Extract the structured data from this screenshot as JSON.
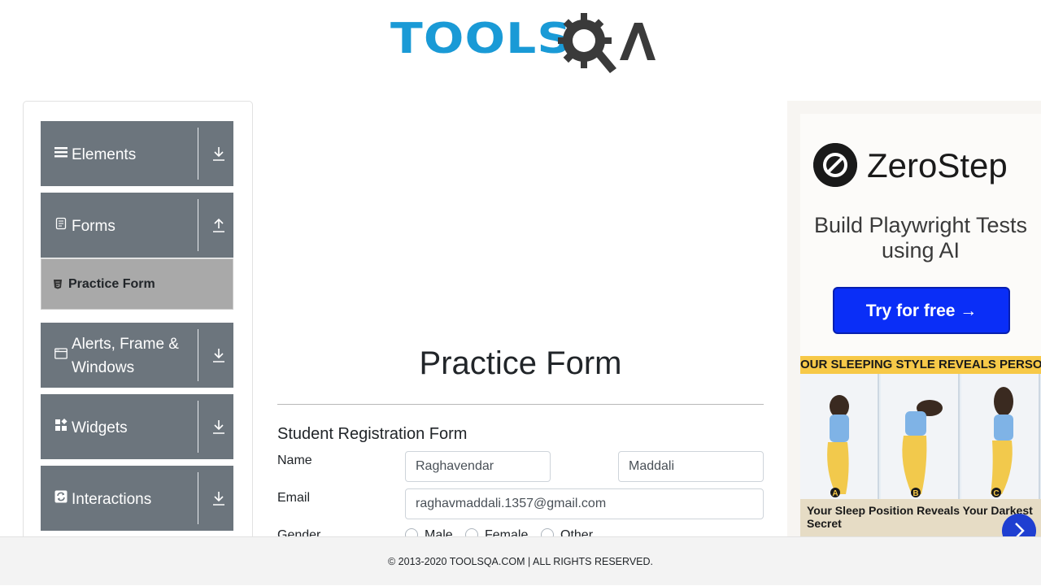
{
  "header": {
    "logo_text": "TOOLSQA",
    "logo_tools": "TOOLS",
    "logo_qa": "QA"
  },
  "sidebar": {
    "groups": [
      {
        "label": "Elements",
        "icon": "hamburger-icon",
        "arrow": "download-arrow-icon"
      },
      {
        "label": "Forms",
        "icon": "document-icon",
        "arrow": "upload-arrow-icon"
      },
      {
        "label": "Alerts, Frame & Windows",
        "icon": "window-icon",
        "arrow": "download-arrow-icon"
      },
      {
        "label": "Widgets",
        "icon": "widgets-icon",
        "arrow": "download-arrow-icon"
      },
      {
        "label": "Interactions",
        "icon": "interactions-icon",
        "arrow": "download-arrow-icon"
      }
    ],
    "active_item": {
      "label": "Practice Form",
      "icon": "html5-icon"
    }
  },
  "main": {
    "title": "Practice Form",
    "form_title": "Student Registration Form",
    "name_label": "Name",
    "first_name": "Raghavendar",
    "last_name": "Maddali",
    "email_label": "Email",
    "email": "raghavmaddali.1357@gmail.com",
    "gender_label": "Gender",
    "gender_options": [
      "Male",
      "Female",
      "Other"
    ]
  },
  "ad": {
    "brand": "ZeroStep",
    "headline": "Build Playwright Tests using AI",
    "cta": "Try for free →",
    "strip": "OUR SLEEPING STYLE REVEALS PERSONALIT",
    "caption": "Your Sleep Position Reveals Your Darkest Secret",
    "pic_labels": [
      "A",
      "B",
      "C"
    ]
  },
  "footer": {
    "text": "© 2013-2020 TOOLSQA.COM | ALL RIGHTS RESERVED."
  },
  "colors": {
    "sidebar_group": "#6c757d",
    "active_item": "#a9a9a9",
    "logo_blue": "#1a9ad6",
    "cta_blue": "#0a2ef7"
  }
}
